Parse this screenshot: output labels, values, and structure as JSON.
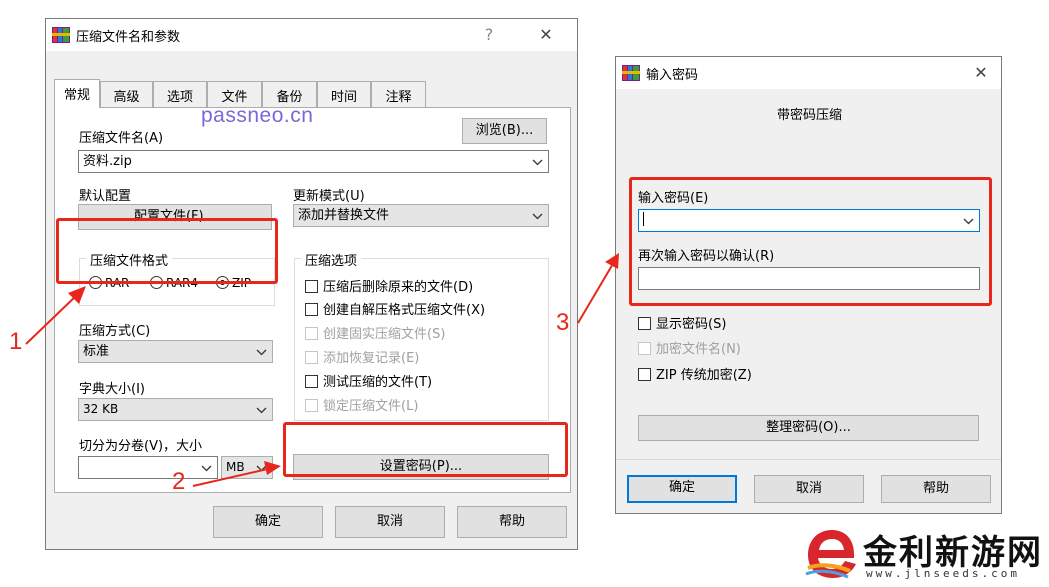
{
  "watermark": "passneo.cn",
  "left_dialog": {
    "title": "压缩文件名和参数",
    "help_glyph": "?",
    "close_glyph": "✕",
    "tabs": [
      "常规",
      "高级",
      "选项",
      "文件",
      "备份",
      "时间",
      "注释"
    ],
    "archive_name_label": "压缩文件名(A)",
    "browse_button": "浏览(B)...",
    "archive_name_value": "资料.zip",
    "default_profile_label": "默认配置",
    "profiles_button": "配置文件(F)...",
    "update_mode_label": "更新模式(U)",
    "update_mode_value": "添加并替换文件",
    "format_group_title": "压缩文件格式",
    "formats": [
      {
        "label": "RAR",
        "selected": false
      },
      {
        "label": "RAR4",
        "selected": false
      },
      {
        "label": "ZIP",
        "selected": true
      }
    ],
    "options_group_title": "压缩选项",
    "options": [
      {
        "label": "压缩后删除原来的文件(D)",
        "checked": false,
        "disabled": false
      },
      {
        "label": "创建自解压格式压缩文件(X)",
        "checked": false,
        "disabled": false
      },
      {
        "label": "创建固实压缩文件(S)",
        "checked": false,
        "disabled": true
      },
      {
        "label": "添加恢复记录(E)",
        "checked": false,
        "disabled": true
      },
      {
        "label": "测试压缩的文件(T)",
        "checked": false,
        "disabled": false
      },
      {
        "label": "锁定压缩文件(L)",
        "checked": false,
        "disabled": true
      }
    ],
    "method_label": "压缩方式(C)",
    "method_value": "标准",
    "dict_label": "字典大小(I)",
    "dict_value": "32 KB",
    "split_label": "切分为分卷(V)，大小",
    "split_value": "",
    "split_unit": "MB",
    "set_password_button": "设置密码(P)...",
    "ok_button": "确定",
    "cancel_button": "取消",
    "help_button": "帮助"
  },
  "right_dialog": {
    "title": "输入密码",
    "close_glyph": "✕",
    "subtitle": "带密码压缩",
    "enter_password_label": "输入密码(E)",
    "enter_password_value": "",
    "confirm_password_label": "再次输入密码以确认(R)",
    "confirm_password_value": "",
    "checkboxes": [
      {
        "label": "显示密码(S)",
        "checked": false,
        "disabled": false
      },
      {
        "label": "加密文件名(N)",
        "checked": false,
        "disabled": true
      },
      {
        "label": "ZIP 传统加密(Z)",
        "checked": false,
        "disabled": false
      }
    ],
    "organize_button": "整理密码(O)...",
    "ok_button": "确定",
    "cancel_button": "取消",
    "help_button": "帮助"
  },
  "annotations": [
    "1",
    "2",
    "3"
  ],
  "logo": {
    "text": "金利新游网",
    "url": "www.jlnseeds.com"
  },
  "colors": {
    "annotation_red": "#e8261b",
    "watermark_purple": "#7b68d8",
    "default_button_blue": "#0078d7"
  }
}
